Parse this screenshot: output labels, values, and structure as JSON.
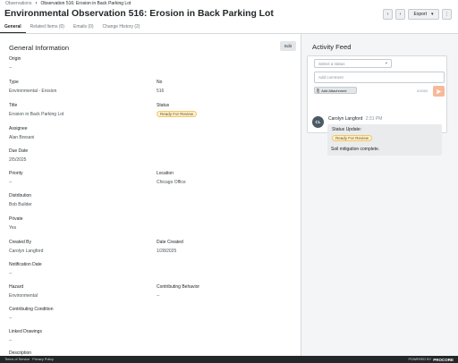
{
  "breadcrumb": {
    "root": "Observations",
    "current": "Observation 516: Erosion in Back Parking Lot"
  },
  "title": "Environmental Observation 516: Erosion in Back Parking Lot",
  "header": {
    "export_label": "Export"
  },
  "tabs": [
    "General",
    "Related Items (0)",
    "Emails (0)",
    "Change History (2)"
  ],
  "general": {
    "section_title": "General Information",
    "edit_label": "Edit",
    "fields": {
      "origin": {
        "label": "Origin",
        "value": "--"
      },
      "type": {
        "label": "Type",
        "value": "Environmental - Erosion"
      },
      "no": {
        "label": "No",
        "value": "516"
      },
      "title": {
        "label": "Title",
        "value": "Erosion in Back Parking Lot"
      },
      "status": {
        "label": "Status",
        "value": "Ready For Review"
      },
      "assignee": {
        "label": "Assignee",
        "value": "Alan Bresani"
      },
      "due_date": {
        "label": "Due Date",
        "value": "2/5/2025"
      },
      "priority": {
        "label": "Priority",
        "value": "--"
      },
      "location": {
        "label": "Location",
        "value": "Chicago Office"
      },
      "distribution": {
        "label": "Distribution",
        "value": "Bob Builder"
      },
      "private": {
        "label": "Private",
        "value": "Yes"
      },
      "created_by": {
        "label": "Created By",
        "value": "Carolyn Langford"
      },
      "date_created": {
        "label": "Date Created",
        "value": "1/28/2025"
      },
      "notification_date": {
        "label": "Notification Date",
        "value": "--"
      },
      "hazard": {
        "label": "Hazard",
        "value": "Environmental"
      },
      "contributing_behavior": {
        "label": "Contributing Behavior",
        "value": "--"
      },
      "contributing_condition": {
        "label": "Contributing Condition",
        "value": "--"
      },
      "linked_drawings": {
        "label": "Linked Drawings",
        "value": "--"
      },
      "description": {
        "label": "Description"
      }
    }
  },
  "activity": {
    "title": "Activity Feed",
    "status_placeholder": "Select a status",
    "comment_placeholder": "Add comment",
    "attach_label": "Add Attachment",
    "char_count": "0/2000",
    "entry": {
      "initials": "CL",
      "author": "Carolyn Langford",
      "time": "2:31 PM",
      "status_label": "Status Update:",
      "status_value": "Ready For Review",
      "comment": "Soil mitigation complete."
    }
  },
  "footer": {
    "terms": "Terms of Service",
    "privacy": "Privacy Policy",
    "powered": "POWERED BY",
    "brand": "PROCORE"
  },
  "colors": {
    "accent": "#f47e42",
    "status_pill_bg": "#fdf1cf",
    "footer_bg": "#232729"
  }
}
